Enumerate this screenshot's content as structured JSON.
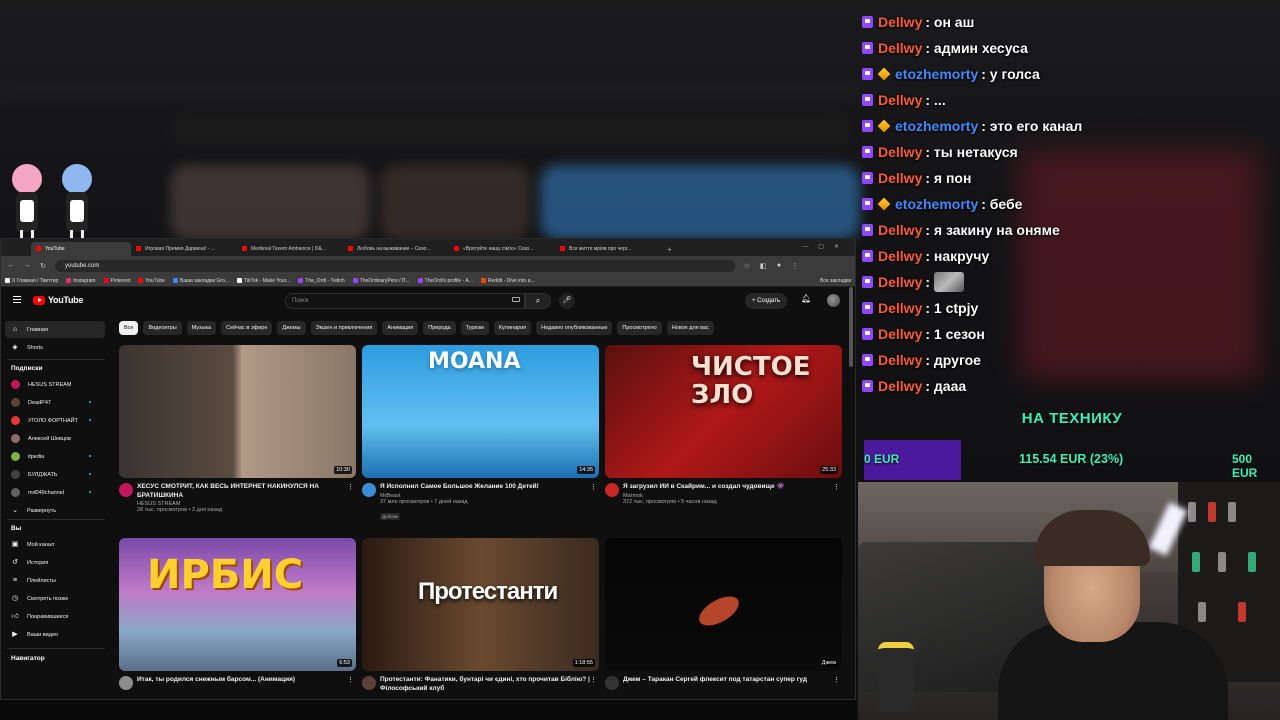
{
  "chat": {
    "messages": [
      {
        "user": "Dellwy",
        "text": ": он аш",
        "badge": "sub",
        "color": "#ff5c33"
      },
      {
        "user": "Dellwy",
        "text": ": админ хесуса",
        "badge": "sub",
        "color": "#ff5c33"
      },
      {
        "user": "etozhemorty",
        "text": ": у голса",
        "badge": "sub+gift",
        "color": "#3f8cff"
      },
      {
        "user": "Dellwy",
        "text": ": ...",
        "badge": "sub",
        "color": "#ff5c33"
      },
      {
        "user": "etozhemorty",
        "text": ": это его канал",
        "badge": "sub+gift",
        "color": "#3f8cff"
      },
      {
        "user": "Dellwy",
        "text": ": ты нетакуся",
        "badge": "sub",
        "color": "#ff5c33"
      },
      {
        "user": "Dellwy",
        "text": ": я пон",
        "badge": "sub",
        "color": "#ff5c33"
      },
      {
        "user": "etozhemorty",
        "text": ": бебе",
        "badge": "sub+gift",
        "color": "#3f8cff"
      },
      {
        "user": "Dellwy",
        "text": ": я закину на оняме",
        "badge": "sub",
        "color": "#ff5c33"
      },
      {
        "user": "Dellwy",
        "text": ": накручу",
        "badge": "sub",
        "color": "#ff5c33"
      },
      {
        "user": "Dellwy",
        "text": ":",
        "badge": "sub",
        "color": "#ff5c33",
        "emote": "emote-icon"
      },
      {
        "user": "Dellwy",
        "text": ": 1 ctpjy",
        "badge": "sub",
        "color": "#ff5c33"
      },
      {
        "user": "Dellwy",
        "text": ": 1 сезон",
        "badge": "sub",
        "color": "#ff5c33"
      },
      {
        "user": "Dellwy",
        "text": ": другое",
        "badge": "sub",
        "color": "#ff5c33"
      },
      {
        "user": "Dellwy",
        "text": ": дааа",
        "badge": "sub",
        "color": "#ff5c33"
      }
    ]
  },
  "goal": {
    "title": "НА ТЕХНИКУ",
    "start": "0 EUR",
    "current": "115.54 EUR (23%)",
    "target": "500 EUR",
    "progress_fraction": 0.23,
    "accent": "#3bf0b8",
    "fill_color": "#4b1a9c"
  },
  "browser": {
    "tabs": [
      "YouTube",
      "Игровая Премия Дарвина! - ...",
      "Medieval Tavern Ambience | D&...",
      "Любовь на выживание – Сезо...",
      "«Врятуйте нашу сім'ю» Сезо...",
      "Все життя мріяв про черг..."
    ],
    "new_tab": "+",
    "url": "youtube.com",
    "bookmarks": [
      "X Главная / Твиттер",
      "Instagram",
      "Pinterest",
      "YouTube",
      "Ваши закладки Gro...",
      "TikTok - Make Your...",
      "The_Ordi - Twitch",
      "TheOrdinaryPers / П...",
      "TheOrdi's profile - A...",
      "Reddit - Dive into a..."
    ],
    "all_bookmarks": "Все закладки"
  },
  "youtube": {
    "logo": "YouTube",
    "search_placeholder": "Поиск",
    "create_label": "Создать",
    "sidebar": {
      "main": [
        {
          "label": "Главная",
          "icon": "home-icon",
          "active": true
        },
        {
          "label": "Shorts",
          "icon": "shorts-icon",
          "active": false
        }
      ],
      "subs_title": "Подписки",
      "subs": [
        {
          "label": "HESUS STREAM",
          "color": "#c2185b"
        },
        {
          "label": "DeadP47",
          "color": "#5d4037"
        },
        {
          "label": "УГОЛО ФОРТНАЙТ",
          "color": "#e53935"
        },
        {
          "label": "Алексей Шевцов",
          "color": "#8d6e63"
        },
        {
          "label": "itpedia",
          "color": "#7cb342"
        },
        {
          "label": "БУЛДЖАТЬ",
          "color": "#424242"
        },
        {
          "label": "md049channel",
          "color": "#616161"
        }
      ],
      "expand_label": "Развернуть",
      "you_title": "Вы",
      "you": [
        {
          "label": "Мой канал",
          "icon": "channel-icon"
        },
        {
          "label": "История",
          "icon": "history-icon"
        },
        {
          "label": "Плейлисты",
          "icon": "playlist-icon"
        },
        {
          "label": "Смотреть позже",
          "icon": "clock-icon"
        },
        {
          "label": "Понравившиеся",
          "icon": "like-icon"
        },
        {
          "label": "Ваши видео",
          "icon": "video-icon"
        }
      ],
      "nav_title": "Навигатор"
    },
    "chips": [
      "Все",
      "Видеоигры",
      "Музыка",
      "Сейчас в эфире",
      "Джемы",
      "Экшен и приключения",
      "Анимация",
      "Природа",
      "Туризм",
      "Кулинария",
      "Недавно опубликованные",
      "Просмотрено",
      "Новое для вас"
    ],
    "videos": [
      {
        "title": "ХЕСУС СМОТРИТ, КАК ВЕСЬ ИНТЕРНЕТ НАКИНУЛСЯ НА БРАТИШКИНА",
        "channel": "HESUS STREAM",
        "stats": "28 тыс. просмотров • 2 дня назад",
        "duration": "10:30",
        "tag": ""
      },
      {
        "title": "Я Исполнил Самое Большое Желание 100 Детей!",
        "channel": "MrBeast",
        "stats": "37 млн просмотров • 7 дней назад",
        "duration": "14:35",
        "tag": "Дубляж",
        "thumb_text": "MOANA"
      },
      {
        "title": "Я загрузил ИИ в Скайрим... и создал чудовище 👾",
        "channel": "Marmok",
        "stats": "372 тыс. просмотров • 5 часов назад",
        "duration": "25:33",
        "tag": "",
        "thumb_text": "ЧИСТОЕ ЗЛО"
      },
      {
        "title": "Итак, ты родился снежным барсом... (Анимация)",
        "channel": "",
        "stats": "",
        "duration": "6:53",
        "tag": "",
        "thumb_text": "ИРБИС"
      },
      {
        "title": "Протестанти: Фанатики, бунтарі чи єдині, хто прочитав Біблію? | Філософський клуб",
        "channel": "",
        "stats": "",
        "duration": "1:18:55",
        "tag": "",
        "thumb_text": "Протестанти"
      },
      {
        "title": "Джем – Таракан Сергей флексит под татарстан супер гуд",
        "channel": "",
        "stats": "",
        "duration": "Джем",
        "tag": ""
      }
    ]
  }
}
